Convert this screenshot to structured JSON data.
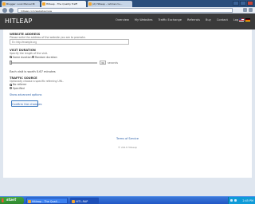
{
  "browser": {
    "tabs": [
      {
        "label": "Blogger: Look Marvel Bl",
        "active": false
      },
      {
        "label": "Hitleap - The Quality Traffi",
        "active": true
      },
      {
        "label": "(2) Hitleap - rahmen tu...",
        "active": false
      }
    ],
    "url": "hitleap.com/websites/new"
  },
  "site": {
    "logo": "HITLEAP",
    "menu": [
      "Overview",
      "My Websites",
      "Traffic Exchange",
      "Referrals",
      "Buy",
      "Contact",
      "Log Out"
    ],
    "flags": [
      "us-flag-icon",
      "de-flag-icon"
    ]
  },
  "form": {
    "website_address_label": "WEBSITE ADDRESS",
    "website_address_hint": "Please write the address of the website you are to promote.",
    "website_address_placeholder": "Ex: http://example.org",
    "visit_duration_label": "VISIT DURATION",
    "visit_duration_hint": "Specify the length of the visit.",
    "visit_options": [
      {
        "label": "Same duration",
        "selected": true
      },
      {
        "label": "Random duration",
        "selected": false
      }
    ],
    "seconds_value": "30",
    "seconds_unit": "seconds",
    "value_text": "Each visit is worth 0.67 minutes",
    "traffic_source_label": "TRAFFIC SOURCE",
    "traffic_source_hint": "Optionally choose a specific referring URL.",
    "traffic_options": [
      {
        "label": "No referrer",
        "selected": true
      },
      {
        "label": "Specified",
        "selected": false
      }
    ],
    "advanced_link": "Show advanced options",
    "submit_label": "Confirm the changes"
  },
  "footer": {
    "link": "Terms of Service",
    "note": "© 2013 HitLeap"
  },
  "taskbar": {
    "start_label": "start",
    "tasks": [
      {
        "label": "Hitleap - The Quali...",
        "active": false
      },
      {
        "label": "HITL-RAP",
        "active": true
      }
    ],
    "clock": "2:45 PM"
  }
}
